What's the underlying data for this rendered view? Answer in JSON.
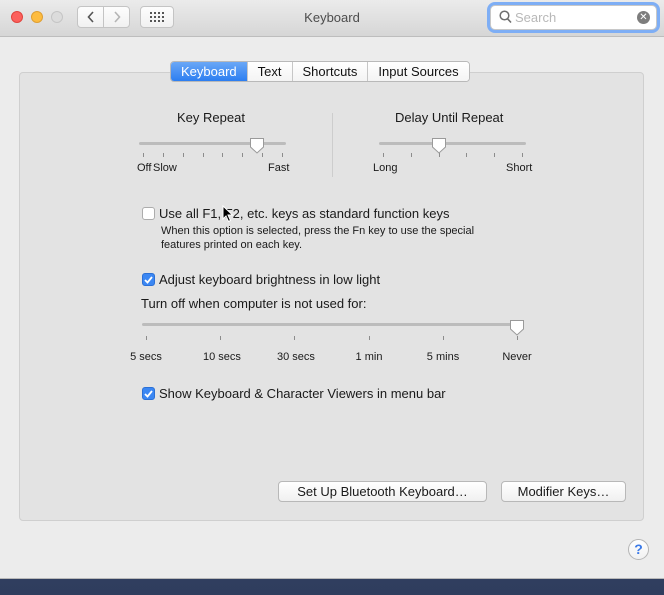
{
  "window": {
    "title": "Keyboard"
  },
  "toolbar": {
    "search_placeholder": "Search",
    "search_value": "",
    "back_icon": "chevron-left-icon",
    "forward_icon": "chevron-right-icon",
    "grid_icon": "show-all-grid-icon",
    "clear_icon": "clear-search-icon"
  },
  "tabs": [
    {
      "label": "Keyboard",
      "selected": true
    },
    {
      "label": "Text",
      "selected": false
    },
    {
      "label": "Shortcuts",
      "selected": false
    },
    {
      "label": "Input Sources",
      "selected": false
    }
  ],
  "key_repeat": {
    "label": "Key Repeat",
    "min_label": "Off",
    "slow_label": "Slow",
    "max_label": "Fast",
    "ticks": 8,
    "value_fraction": 0.82
  },
  "delay_until_repeat": {
    "label": "Delay Until Repeat",
    "min_label": "Long",
    "max_label": "Short",
    "ticks": 6,
    "value_fraction": 0.4
  },
  "fn_keys": {
    "label": "Use all F1, F2, etc. keys as standard function keys",
    "checked": false,
    "description_line1": "When this option is selected, press the Fn key to use the special",
    "description_line2": "features printed on each key."
  },
  "brightness": {
    "label": "Adjust keyboard brightness in low light",
    "checked": true
  },
  "turn_off": {
    "label": "Turn off when computer is not used for:",
    "ticks": [
      "5 secs",
      "10 secs",
      "30 secs",
      "1 min",
      "5 mins",
      "Never"
    ],
    "value_index": 5
  },
  "viewers": {
    "label": "Show Keyboard & Character Viewers in menu bar",
    "checked": true
  },
  "buttons": {
    "bluetooth": "Set Up Bluetooth Keyboard…",
    "modifier": "Modifier Keys…"
  },
  "help_label": "?",
  "colors": {
    "accent": "#3b87f3",
    "close": "#fc605c",
    "minimize": "#fdbc40"
  }
}
